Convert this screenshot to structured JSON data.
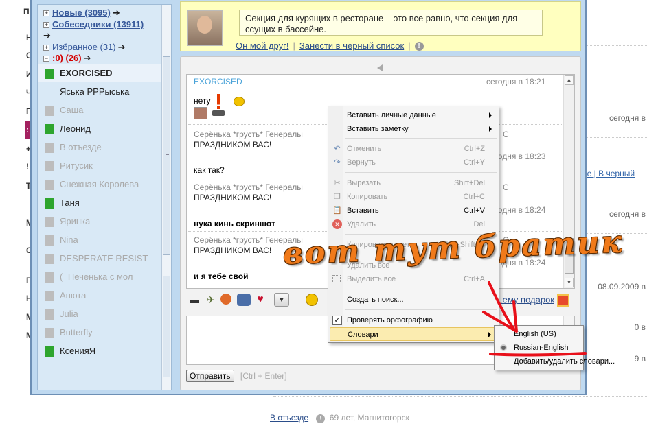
{
  "background_page": {
    "left_letters": [
      "Па",
      "Н",
      "С",
      "И",
      "Ч",
      "П",
      ":",
      "+",
      "!",
      "Т",
      "М",
      "С",
      "П",
      "Н",
      "М",
      "М"
    ],
    "right": {
      "time_1": "сегодня в",
      "links_row": "ре | В черный",
      "time_2": "сегодня в",
      "date_1": "08.09.2009 в",
      "frag_1": "0 в",
      "frag_2": "9 в"
    },
    "footer": {
      "status_link": "В отъезде",
      "info": "69 лет, Магнитогорск"
    }
  },
  "sidebar": {
    "groups": [
      {
        "label": "Новые (3095)",
        "toggle": "+"
      },
      {
        "label": "Собеседники (13911)",
        "toggle": "+"
      },
      {
        "label": "Избранное (31)",
        "toggle": "+"
      },
      {
        "label": ":0) (26)",
        "toggle": "−"
      }
    ],
    "contacts": [
      {
        "name": "EXORCISED",
        "status": "online",
        "selected": true
      },
      {
        "name": "Яська РРРыська",
        "status": "none"
      },
      {
        "name": "Саша",
        "status": "offline"
      },
      {
        "name": "Леонид",
        "status": "online"
      },
      {
        "name": "В отъезде",
        "status": "offline"
      },
      {
        "name": "Ритусик",
        "status": "offline"
      },
      {
        "name": "Снежная Королева",
        "status": "offline"
      },
      {
        "name": "Таня",
        "status": "online"
      },
      {
        "name": "Яринка",
        "status": "offline"
      },
      {
        "name": "Nina",
        "status": "offline"
      },
      {
        "name": "DESPERATE RESIST",
        "status": "offline"
      },
      {
        "name": "(=Печенька с мол",
        "status": "offline"
      },
      {
        "name": "Анюта",
        "status": "offline"
      },
      {
        "name": "Julia",
        "status": "offline"
      },
      {
        "name": "Butterfly",
        "status": "offline"
      },
      {
        "name": "КсенияЯ",
        "status": "online"
      }
    ]
  },
  "friend": {
    "quote": "Секция для курящих в ресторане – это все равно, что секция для ссущих в бассейне.",
    "link_friend": "Он мой друг!",
    "link_block": "Занести в черный список"
  },
  "chat": {
    "messages": [
      {
        "author": "EXORCISED",
        "time": "сегодня в 18:21",
        "text": "нету"
      },
      {
        "author": "Серёнька *грусть* Генералы",
        "time_frag": "С",
        "text": "ПРАЗДНИКОМ ВАС!"
      },
      {
        "author": "",
        "time": "сегодня в 18:23",
        "text": "как так?"
      },
      {
        "author": "Серёнька *грусть* Генералы",
        "time_frag": "С",
        "text": "ПРАЗДНИКОМ ВАС!"
      },
      {
        "author": "",
        "time": "сегодня в 18:24",
        "text": "нука кинь скриншот"
      },
      {
        "author": "Серёнька *грусть* Генералы",
        "time_frag": "С",
        "text": "ПРАЗДНИКОМ ВАС!"
      },
      {
        "author": "",
        "time": "сегодня в 18:24",
        "text": "и я тебе свой"
      }
    ],
    "gift_link": "...ему подарок",
    "send_button": "Отправить",
    "send_hint": "[Ctrl + Enter]"
  },
  "context_menu": {
    "items": [
      {
        "label": "Вставить личные данные",
        "submenu": true,
        "disabled": false
      },
      {
        "label": "Вставить заметку",
        "submenu": true,
        "disabled": false
      },
      {
        "label": "Отменить",
        "shortcut": "Ctrl+Z",
        "disabled": true
      },
      {
        "label": "Вернуть",
        "shortcut": "Ctrl+Y",
        "disabled": true
      },
      {
        "label": "Вырезать",
        "shortcut": "Shift+Del",
        "disabled": true
      },
      {
        "label": "Копировать",
        "shortcut": "Ctrl+C",
        "disabled": true
      },
      {
        "label": "Вставить",
        "shortcut": "Ctrl+V",
        "disabled": false
      },
      {
        "label": "Удалить",
        "shortcut": "Del",
        "disabled": true
      },
      {
        "label": "Копировать заметки",
        "shortcut": "Ctrl+Shift+C",
        "disabled": true
      },
      {
        "label": "Удалить все",
        "disabled": true
      },
      {
        "label": "Выделить все",
        "shortcut": "Ctrl+A",
        "disabled": true
      },
      {
        "label": "Создать поиск...",
        "disabled": false
      },
      {
        "label": "Проверять орфографию",
        "checked": true,
        "disabled": false
      },
      {
        "label": "Словари",
        "submenu": true,
        "highlighted": true,
        "disabled": false
      }
    ]
  },
  "dictionary_submenu": {
    "items": [
      {
        "label": "English (US)",
        "selected": false
      },
      {
        "label": "Russian-English",
        "selected": true
      },
      {
        "label": "Добавить/удалить словари..."
      }
    ]
  },
  "annotation": {
    "text": "вот тут братик",
    "color": "#f07a1a",
    "arrow_color": "#e8101a"
  }
}
